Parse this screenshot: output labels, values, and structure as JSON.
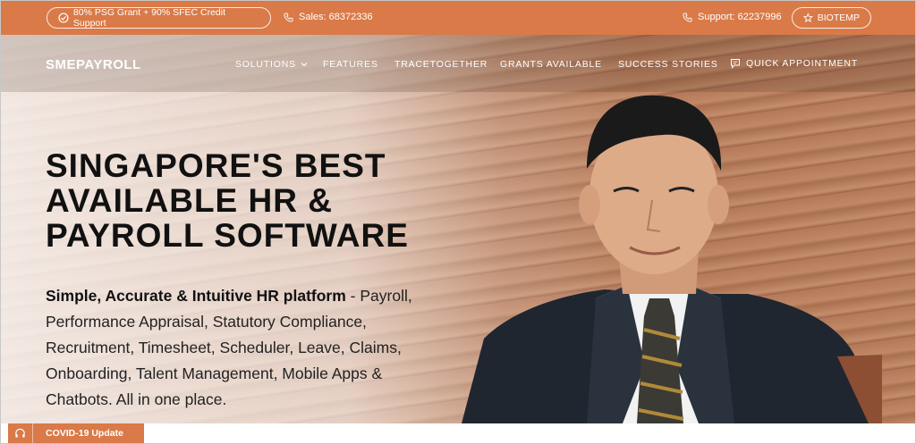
{
  "topbar": {
    "grant_label": "80% PSG Grant + 90% SFEC Credit Support",
    "sales_label": "Sales: 68372336",
    "support_label": "Support: 62237996",
    "biotemp_label": "BIOTEMP"
  },
  "nav": {
    "logo": "SMEPAYROLL",
    "solutions": "SOLUTIONS",
    "features": "FEATURES",
    "tracetogether": "TRACETOGETHER",
    "grants": "GRANTS AVAILABLE",
    "stories": "SUCCESS STORIES",
    "appointment": "QUICK APPOINTMENT"
  },
  "hero": {
    "headline": [
      "SINGAPORE'S BEST",
      "AVAILABLE HR &",
      "PAYROLL SOFTWARE"
    ],
    "desc_bold": "Simple, Accurate & Intuitive HR platform",
    "desc_rest": " - Payroll, Performance Appraisal, Statutory Compliance, Recruitment, Timesheet, Scheduler, Leave, Claims, Onboarding, Talent Management, Mobile Apps & Chatbots. All in one place."
  },
  "covid": {
    "label": "COVID-19 Update"
  },
  "colors": {
    "accent": "#d97a48"
  },
  "icons": [
    "check-circle-icon",
    "phone-icon",
    "star-icon",
    "chevron-down-icon",
    "chat-icon",
    "headset-icon"
  ]
}
